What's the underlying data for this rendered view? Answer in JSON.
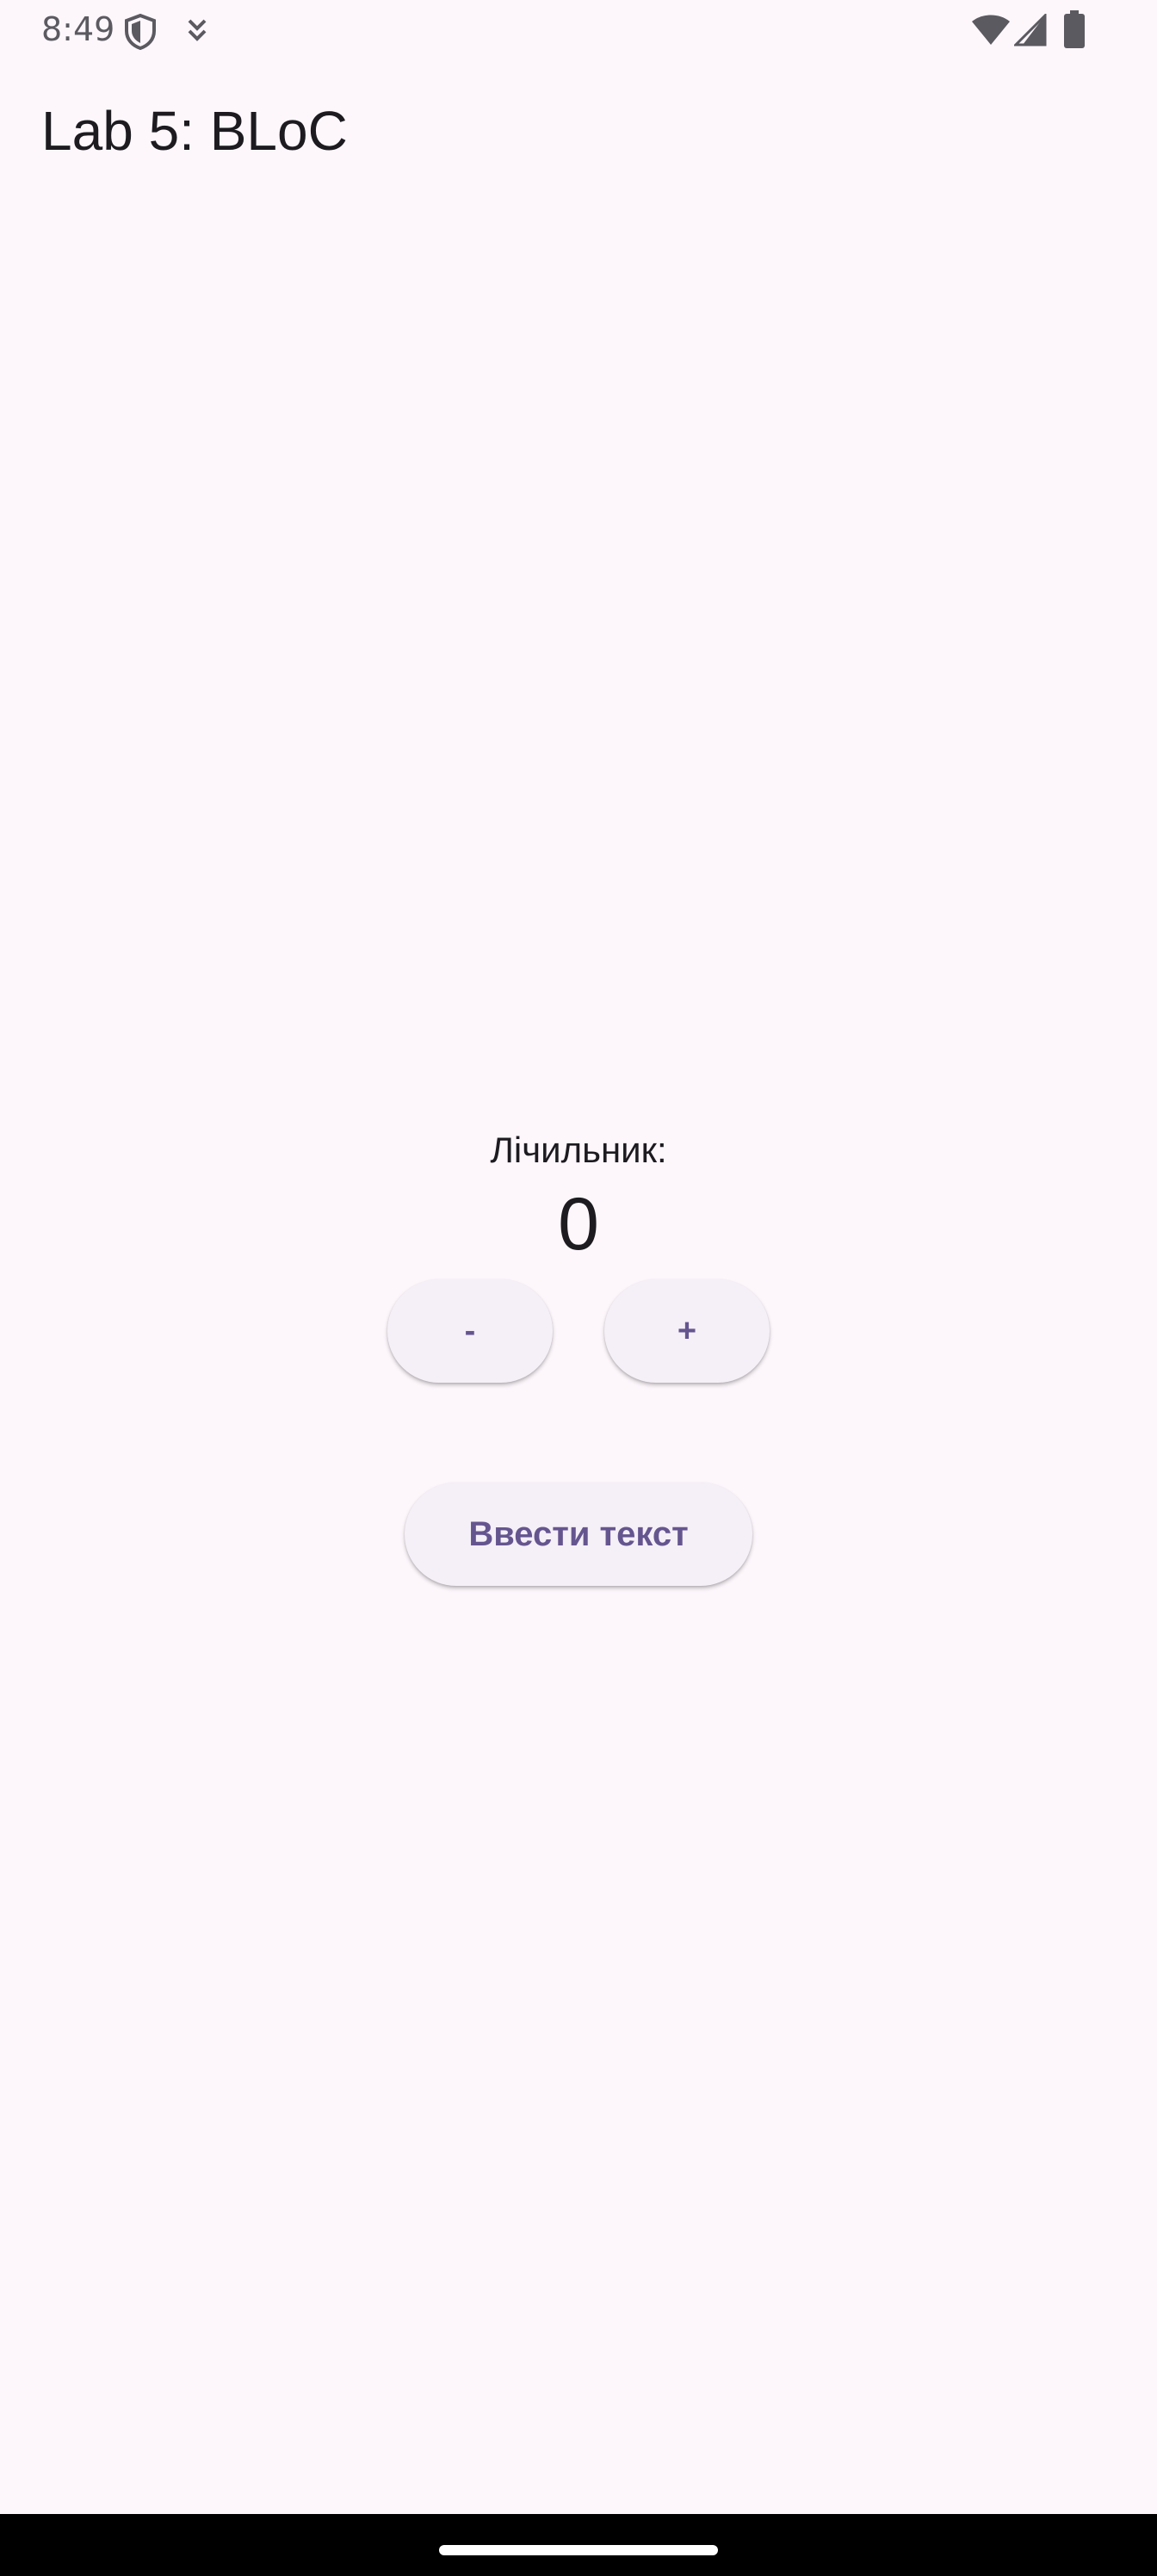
{
  "status_bar": {
    "time": "8:49",
    "icons_left": [
      "shield-icon",
      "download-icon"
    ],
    "icons_right": [
      "wifi-icon",
      "signal-icon",
      "battery-icon"
    ]
  },
  "app_bar": {
    "title": "Lab 5: BLoC"
  },
  "counter": {
    "label": "Лічильник:",
    "value": "0"
  },
  "buttons": {
    "decrement_label": "-",
    "increment_label": "+",
    "enter_text_label": "Ввести текст"
  },
  "colors": {
    "background": "#fdf7fc",
    "button_bg": "#f5eff7",
    "button_text": "#65558f",
    "text_primary": "#1d1b20"
  }
}
